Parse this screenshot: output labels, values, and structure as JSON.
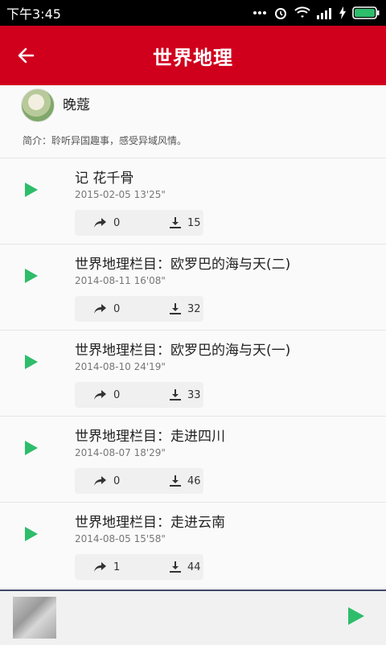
{
  "status": {
    "time": "下午3:45"
  },
  "header": {
    "title": "世界地理"
  },
  "album": {
    "author": "晚蔻",
    "intro": "简介：聆听异国趣事，感受异域风情。"
  },
  "episodes": [
    {
      "title": "记 花千骨",
      "date": "2015-02-05",
      "duration": "13'25\"",
      "shares": "0",
      "downloads": "15"
    },
    {
      "title": "世界地理栏目：欧罗巴的海与天(二)",
      "date": "2014-08-11",
      "duration": "16'08\"",
      "shares": "0",
      "downloads": "32"
    },
    {
      "title": "世界地理栏目：欧罗巴的海与天(一)",
      "date": "2014-08-10",
      "duration": "24'19\"",
      "shares": "0",
      "downloads": "33"
    },
    {
      "title": "世界地理栏目：走进四川",
      "date": "2014-08-07",
      "duration": "18'29\"",
      "shares": "0",
      "downloads": "46"
    },
    {
      "title": "世界地理栏目：走进云南",
      "date": "2014-08-05",
      "duration": "15'58\"",
      "shares": "1",
      "downloads": "44"
    }
  ],
  "colors": {
    "brand": "#d0001d",
    "play": "#2ebd6b"
  },
  "icons": {
    "back": "arrow-left-icon",
    "play": "play-icon",
    "share": "share-icon",
    "download": "download-icon"
  }
}
